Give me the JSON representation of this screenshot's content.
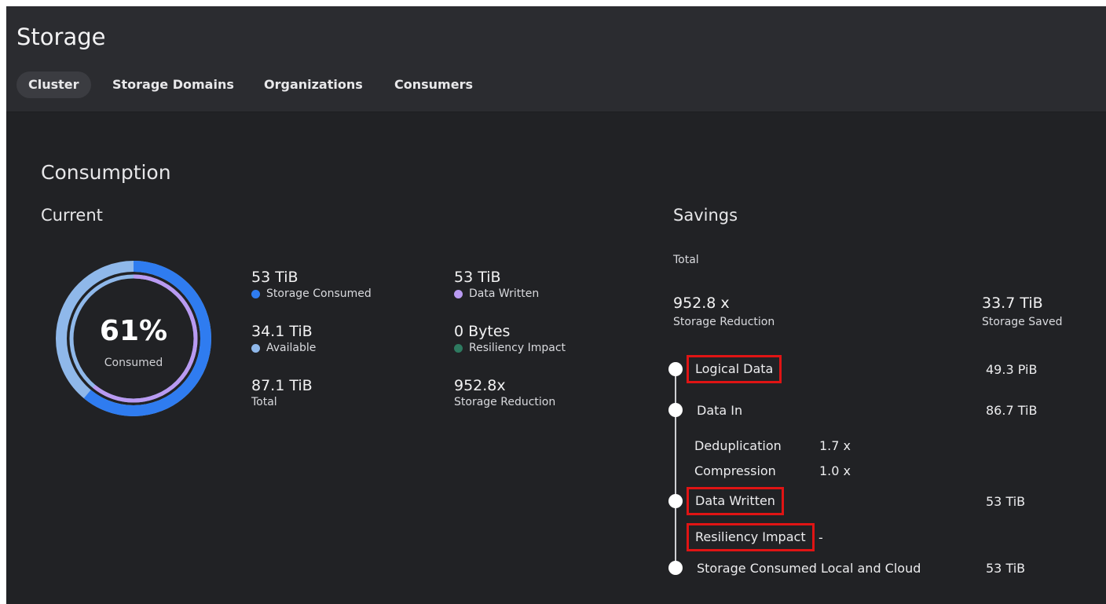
{
  "page": {
    "title": "Storage"
  },
  "tabs": [
    {
      "label": "Cluster",
      "active": true
    },
    {
      "label": "Storage Domains",
      "active": false
    },
    {
      "label": "Organizations",
      "active": false
    },
    {
      "label": "Consumers",
      "active": false
    }
  ],
  "consumption": {
    "title": "Consumption",
    "current": {
      "title": "Current",
      "donut": {
        "percent": "61%",
        "label": "Consumed",
        "consumed_fraction": 0.61
      },
      "stats": [
        {
          "value": "53 TiB",
          "label": "Storage Consumed",
          "dot_color": "#2f7cf0"
        },
        {
          "value": "34.1 TiB",
          "label": "Available",
          "dot_color": "#8fb8ea"
        },
        {
          "value": "87.1 TiB",
          "label": "Total"
        },
        {
          "value": "53 TiB",
          "label": "Data Written",
          "dot_color": "#b99af2"
        },
        {
          "value": "0 Bytes",
          "label": "Resiliency Impact",
          "dot_color": "#2e7a60"
        },
        {
          "value": "952.8x",
          "label": "Storage Reduction"
        }
      ]
    },
    "savings": {
      "title": "Savings",
      "total_label": "Total",
      "reduction": {
        "value": "952.8 x",
        "label": "Storage Reduction"
      },
      "saved": {
        "value": "33.7 TiB",
        "label": "Storage Saved"
      },
      "rows": {
        "logical_data": {
          "label": "Logical Data",
          "value": "49.3 PiB"
        },
        "data_in": {
          "label": "Data In",
          "value": "86.7 TiB"
        },
        "deduplication": {
          "label": "Deduplication",
          "value": "1.7 x"
        },
        "compression": {
          "label": "Compression",
          "value": "1.0 x"
        },
        "data_written": {
          "label": "Data Written",
          "value": "53 TiB"
        },
        "resiliency_impact": {
          "label": "Resiliency Impact",
          "value": "-"
        },
        "storage_consumed": {
          "label": "Storage Consumed Local and Cloud",
          "value": "53 TiB"
        }
      }
    }
  },
  "colors": {
    "consumed": "#2f7cf0",
    "available": "#8fb8ea",
    "data_written": "#b99af2",
    "resiliency": "#2e7a60",
    "highlight_box": "#e01414"
  }
}
